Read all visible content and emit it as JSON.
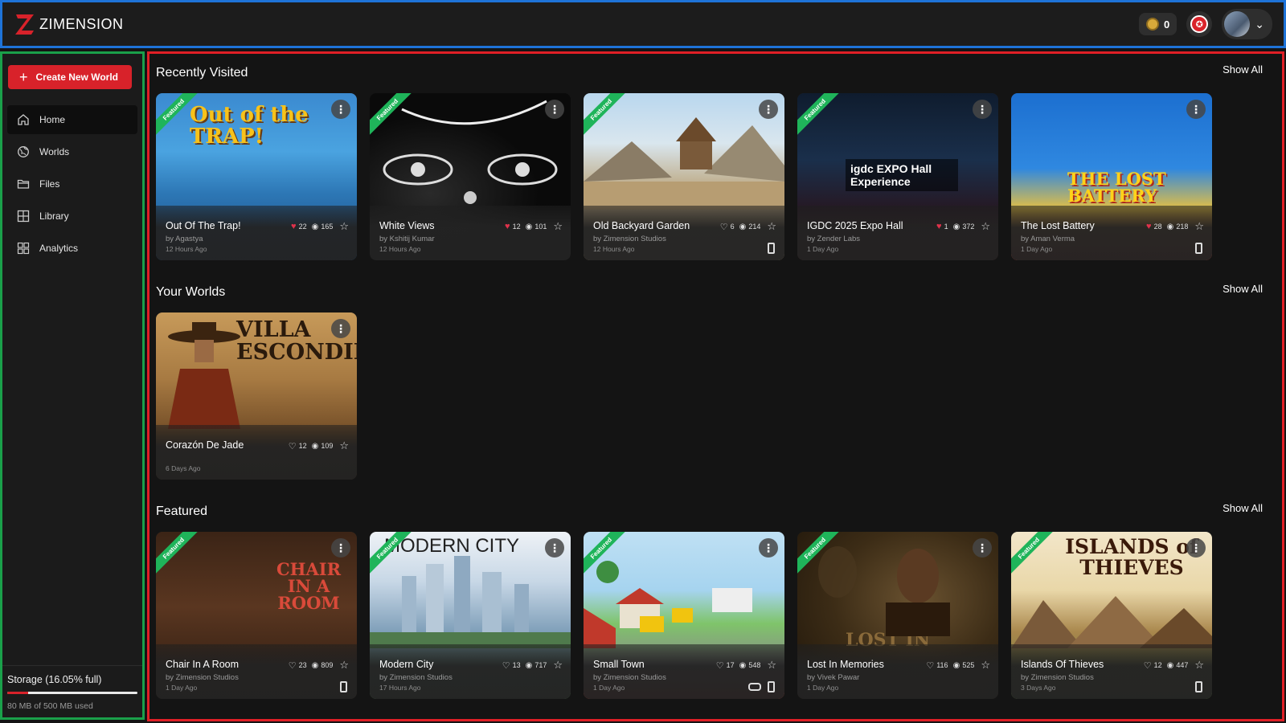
{
  "header": {
    "brand": "ZIMENSION",
    "coins": "0",
    "colors": {
      "header_border": "#1e73d8",
      "brand_red": "#d8222a"
    }
  },
  "sidebar": {
    "create_button": "Create New World",
    "nav": [
      {
        "label": "Home",
        "icon": "home-icon",
        "active": true
      },
      {
        "label": "Worlds",
        "icon": "globe-icon",
        "active": false
      },
      {
        "label": "Files",
        "icon": "folder-icon",
        "active": false
      },
      {
        "label": "Library",
        "icon": "library-icon",
        "active": false
      },
      {
        "label": "Analytics",
        "icon": "analytics-icon",
        "active": false
      }
    ],
    "storage": {
      "label": "Storage (16.05% full)",
      "used_text": "80 MB of 500 MB used",
      "fraction": 0.1605
    }
  },
  "sections": {
    "recent": {
      "title": "Recently Visited",
      "show_all": "Show All"
    },
    "yours": {
      "title": "Your Worlds",
      "show_all": "Show All"
    },
    "featured": {
      "title": "Featured",
      "show_all": "Show All"
    }
  },
  "featured_label": "Featured",
  "recent_cards": [
    {
      "title": "Out Of The Trap!",
      "author": "by Agastya",
      "time": "12 Hours Ago",
      "likes": "22",
      "views": "165",
      "liked": true,
      "featured": true,
      "phone": false,
      "vr": false
    },
    {
      "title": "White Views",
      "author": "by Kshitij Kumar",
      "time": "12 Hours Ago",
      "likes": "12",
      "views": "101",
      "liked": true,
      "featured": true,
      "phone": false,
      "vr": false
    },
    {
      "title": "Old Backyard Garden",
      "author": "by Zimension Studios",
      "time": "12 Hours Ago",
      "likes": "6",
      "views": "214",
      "liked": false,
      "featured": true,
      "phone": true,
      "vr": false
    },
    {
      "title": "IGDC 2025 Expo Hall",
      "author": "by Zender Labs",
      "time": "1 Day Ago",
      "likes": "1",
      "views": "372",
      "liked": true,
      "featured": true,
      "phone": false,
      "vr": false
    },
    {
      "title": "The Lost Battery",
      "author": "by Aman Verma",
      "time": "1 Day Ago",
      "likes": "28",
      "views": "218",
      "liked": true,
      "featured": false,
      "phone": true,
      "vr": false
    }
  ],
  "your_cards": [
    {
      "title": "Corazón De Jade",
      "author": "",
      "time": "6 Days Ago",
      "likes": "12",
      "views": "109",
      "liked": false,
      "featured": false,
      "phone": false,
      "vr": false
    }
  ],
  "featured_cards": [
    {
      "title": "Chair In A Room",
      "author": "by Zimension Studios",
      "time": "1 Day Ago",
      "likes": "23",
      "views": "809",
      "liked": false,
      "featured": true,
      "phone": true,
      "vr": false
    },
    {
      "title": "Modern City",
      "author": "by Zimension Studios",
      "time": "17 Hours Ago",
      "likes": "13",
      "views": "717",
      "liked": false,
      "featured": true,
      "phone": false,
      "vr": false
    },
    {
      "title": "Small Town",
      "author": "by Zimension Studios",
      "time": "1 Day Ago",
      "likes": "17",
      "views": "548",
      "liked": false,
      "featured": true,
      "phone": true,
      "vr": true
    },
    {
      "title": "Lost In Memories",
      "author": "by Vivek Pawar",
      "time": "1 Day Ago",
      "likes": "116",
      "views": "525",
      "liked": false,
      "featured": true,
      "phone": false,
      "vr": false
    },
    {
      "title": "Islands Of Thieves",
      "author": "by Zimension Studios",
      "time": "3 Days Ago",
      "likes": "12",
      "views": "447",
      "liked": false,
      "featured": true,
      "phone": true,
      "vr": false
    }
  ],
  "thumb_art": {
    "trap": "Out of the TRAP!",
    "battery": "THE LOST BATTERY",
    "villa": "VILLA ESCONDIDA",
    "chair": "CHAIR IN A ROOM",
    "city": "MODERN CITY",
    "memories": "LOST IN",
    "islands": "ISLANDS of THIEVES",
    "igdc": "igdc EXPO Hall Experience"
  }
}
